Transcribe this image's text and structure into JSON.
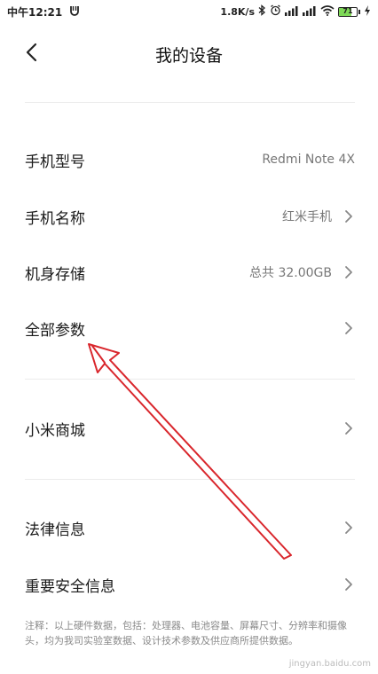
{
  "status": {
    "time": "中午12:21",
    "network_speed": "1.8K/s",
    "battery_level": "71",
    "battery_fraction": 0.71,
    "battery_color": "#7ed957"
  },
  "header": {
    "title": "我的设备",
    "back_icon": "chevron-left-icon"
  },
  "rows": [
    {
      "label": "手机型号",
      "value": "Redmi Note 4X",
      "chevron": false
    },
    {
      "label": "手机名称",
      "value": "红米手机",
      "chevron": true
    },
    {
      "label": "机身存储",
      "value": "总共 32.00GB",
      "chevron": true
    },
    {
      "label": "全部参数",
      "value": "",
      "chevron": true
    },
    {
      "label": "小米商城",
      "value": "",
      "chevron": true
    },
    {
      "label": "法律信息",
      "value": "",
      "chevron": true
    },
    {
      "label": "重要安全信息",
      "value": "",
      "chevron": true
    }
  ],
  "note": "注释：以上硬件数据，包括：处理器、电池容量、屏幕尺寸、分辨率和摄像头，均为我司实验室数据、设计技术参数及供应商所提供数据。",
  "watermark": "jingyan.baidu.com",
  "annotation_color": "#d9262c"
}
